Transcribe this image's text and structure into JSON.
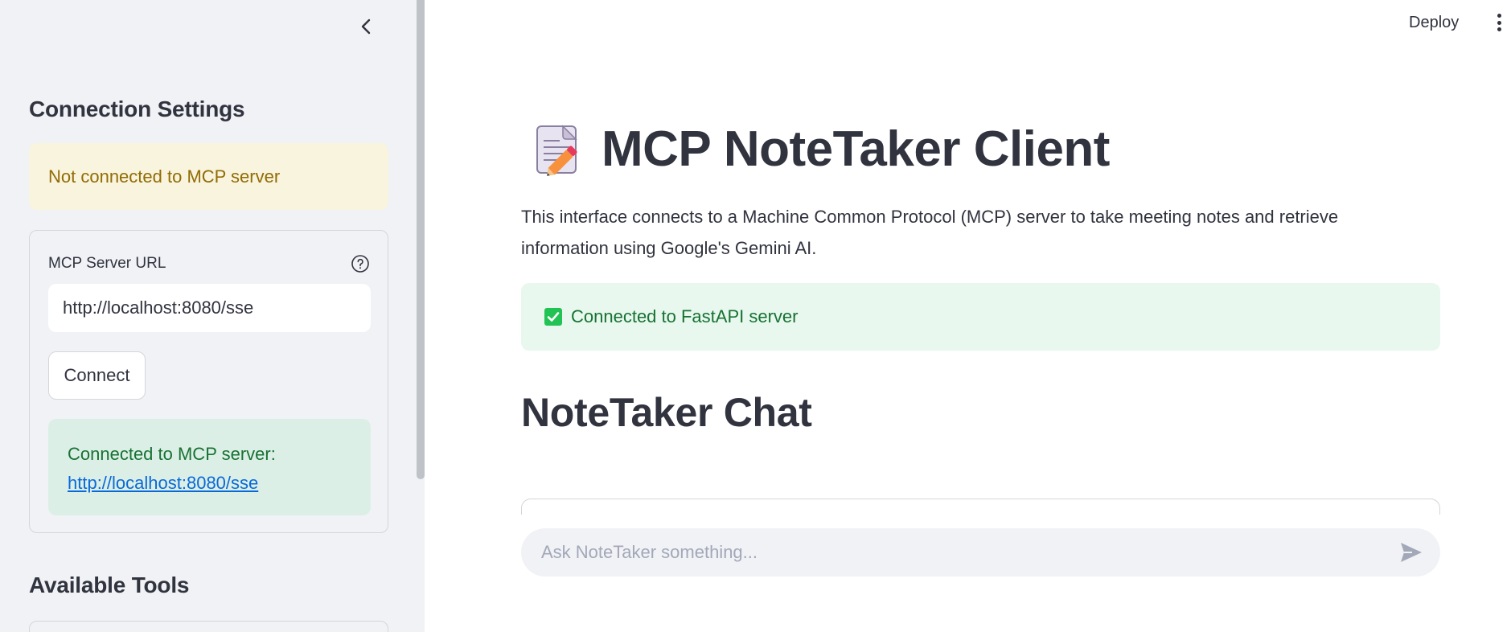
{
  "sidebar": {
    "connection_heading": "Connection Settings",
    "warning_text": "Not connected to MCP server",
    "server_url_label": "MCP Server URL",
    "server_url_value": "http://localhost:8080/sse",
    "connect_label": "Connect",
    "connected_text": "Connected to MCP server:",
    "connected_url": "http://localhost:8080/sse",
    "tools_heading": "Available Tools"
  },
  "header": {
    "deploy_label": "Deploy"
  },
  "main": {
    "title_emoji": "memo-icon",
    "title": "MCP NoteTaker Client",
    "description": "This interface connects to a Machine Common Protocol (MCP) server to take meeting notes and retrieve information using Google's Gemini AI.",
    "fastapi_status": "Connected to FastAPI server",
    "chat_heading": "NoteTaker Chat",
    "chat_placeholder": "Ask NoteTaker something..."
  },
  "colors": {
    "sidebar_bg": "#f0f2f6",
    "warning_bg": "#f8f4dd",
    "warning_text": "#926c05",
    "success_bg": "#dcefe6",
    "success_text": "#177233",
    "link": "#0969da",
    "check": "#21c354"
  }
}
